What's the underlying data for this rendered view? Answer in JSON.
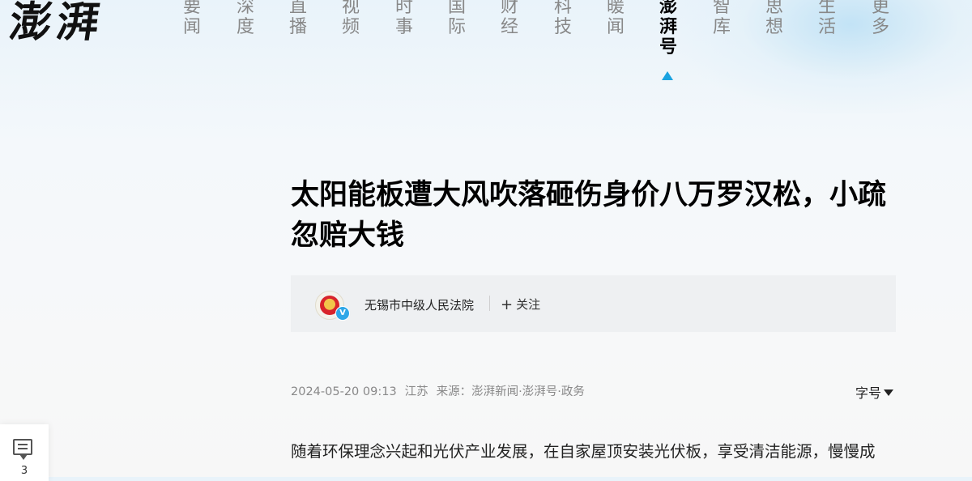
{
  "logo": "澎湃",
  "nav": {
    "items": [
      {
        "label": "要闻",
        "active": false
      },
      {
        "label": "深度",
        "active": false
      },
      {
        "label": "直播",
        "active": false
      },
      {
        "label": "视频",
        "active": false
      },
      {
        "label": "时事",
        "active": false
      },
      {
        "label": "国际",
        "active": false
      },
      {
        "label": "财经",
        "active": false
      },
      {
        "label": "科技",
        "active": false
      },
      {
        "label": "暖闻",
        "active": false
      },
      {
        "label": "澎湃号",
        "active": true
      },
      {
        "label": "智库",
        "active": false
      },
      {
        "label": "思想",
        "active": false
      },
      {
        "label": "生活",
        "active": false
      },
      {
        "label": "更多",
        "active": false
      }
    ]
  },
  "article": {
    "title": "太阳能板遭大风吹落砸伤身价八万罗汉松，小疏忽赔大钱",
    "author": {
      "name": "无锡市中级人民法院",
      "verified_badge": "V",
      "follow_label": "关注"
    },
    "meta": {
      "datetime": "2024-05-20 09:13",
      "location": "江苏",
      "source": "来源：澎湃新闻·澎湃号·政务"
    },
    "font_size_label": "字号",
    "body_first_line": "随着环保理念兴起和光伏产业发展，在自家屋顶安装光伏板，享受清洁能源，慢慢成"
  },
  "comment": {
    "count": "3"
  },
  "colors": {
    "accent": "#1aa3e0",
    "verified": "#2ea7e8"
  }
}
